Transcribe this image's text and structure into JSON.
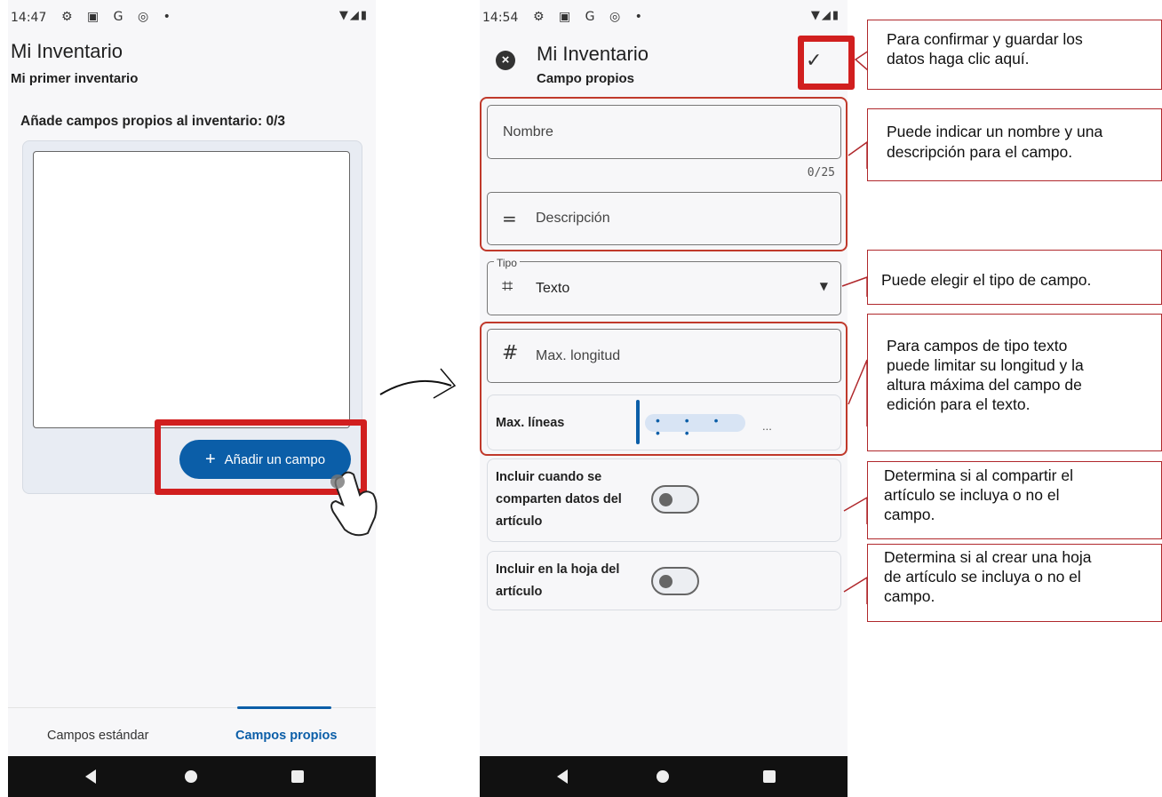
{
  "left_phone": {
    "status_time": "14:47",
    "app_title": "Mi Inventario",
    "app_subtitle": "Mi primer inventario",
    "section_label": "Añade campos propios al inventario: 0/3",
    "add_button_label": "Añadir un campo",
    "tabs": [
      {
        "label": "Campos estándar",
        "active": false
      },
      {
        "label": "Campos propios",
        "active": true
      }
    ]
  },
  "right_phone": {
    "status_time": "14:54",
    "app_title": "Mi Inventario",
    "app_subtitle": "Campo propios",
    "name_placeholder": "Nombre",
    "name_counter": "0/25",
    "description_placeholder": "Descripción",
    "type_legend": "Tipo",
    "type_value": "Texto",
    "max_length_placeholder": "Max. longitud",
    "max_lines_label": "Max. líneas",
    "max_lines_ellipsis": "...",
    "share_toggle_label": [
      "Incluir cuando se",
      "comparten datos del",
      "artículo"
    ],
    "share_toggle_on": false,
    "sheet_toggle_label": [
      "Incluir en la hoja del",
      "artículo"
    ],
    "sheet_toggle_on": false
  },
  "callouts": {
    "confirm": [
      "Para confirmar y guardar los",
      "datos haga clic aquí."
    ],
    "name_desc": [
      "Puede indicar un nombre y una",
      "descripción para el campo."
    ],
    "type": [
      "Puede elegir el tipo de campo."
    ],
    "text_limits": [
      "Para campos de tipo texto",
      "puede limitar su longitud y la",
      "altura máxima del campo de",
      "edición para el texto."
    ],
    "share": [
      "Determina si al compartir el",
      "artículo se incluya o no el",
      "campo."
    ],
    "sheet": [
      "Determina si al crear una hoja",
      "de artículo se incluya o no el",
      "campo."
    ]
  },
  "colors": {
    "accent": "#0b5ea8",
    "highlight": "#d11f1f",
    "callout_border": "#b0282c"
  },
  "icons": {
    "status_icons": "settings-icon, a-icon, google-icon, circle-icon",
    "close": "close-circle-icon",
    "confirm": "check-icon",
    "description": "short-text-icon",
    "type": "crop-icon",
    "max_length": "hash-icon",
    "dropdown": "caret-down-icon",
    "pointer": "hand-pointer-icon"
  }
}
